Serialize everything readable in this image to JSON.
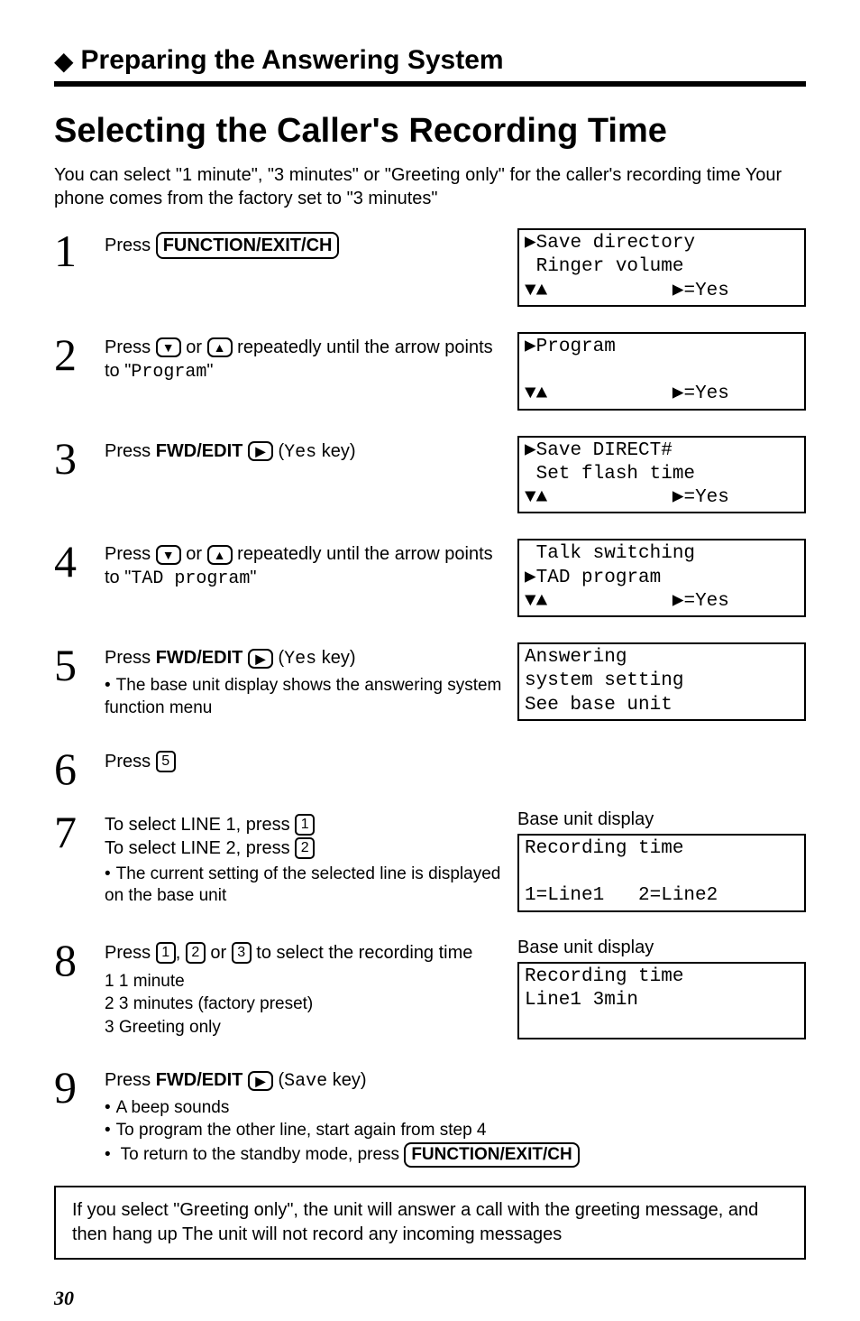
{
  "section": {
    "prefix_arrow": "◆",
    "title": "Preparing the Answering System"
  },
  "main_title": "Selecting the Caller's Recording Time",
  "intro": "You can select \"1 minute\", \"3 minutes\" or \"Greeting only\" for the caller's recording time  Your phone comes from the factory set to \"3 minutes\"",
  "keys": {
    "function_exit_ch": "FUNCTION/EXIT/CH",
    "fwd_edit": "FWD/EDIT",
    "down": "▼",
    "up": "▲",
    "play": "▶",
    "k1": "1",
    "k2": "2",
    "k3": "3",
    "k5": "5"
  },
  "steps": {
    "s1": {
      "num": "1",
      "text_a": "Press "
    },
    "s2": {
      "num": "2",
      "text_a": "Press ",
      "text_b": " or ",
      "text_c": " repeatedly until the arrow points to \"",
      "prog_word": "Program",
      "text_d": "\""
    },
    "s3": {
      "num": "3",
      "text_a": "Press ",
      "text_b": " (",
      "yes_word": "Yes",
      "text_c": " key)"
    },
    "s4": {
      "num": "4",
      "text_a": "Press ",
      "text_b": " or ",
      "text_c": " repeatedly until the arrow points to \"",
      "prog_word": "TAD program",
      "text_d": "\""
    },
    "s5": {
      "num": "5",
      "text_a": "Press ",
      "text_b": " (",
      "yes_word": "Yes",
      "text_c": " key)",
      "bullet": "The base unit display shows the answering system function menu"
    },
    "s6": {
      "num": "6",
      "text_a": "Press "
    },
    "s7": {
      "num": "7",
      "line1_a": "To select LINE 1, press ",
      "line2_a": "To select LINE 2, press ",
      "bullet": "The current setting of the selected line is displayed on the base unit"
    },
    "s8": {
      "num": "8",
      "text_a": "Press ",
      "text_b": ", ",
      "text_c": " or ",
      "text_d": " to select the recording time",
      "opt1": "1  1 minute",
      "opt2": "2  3 minutes (factory preset)",
      "opt3": "3  Greeting only"
    },
    "s9": {
      "num": "9",
      "text_a": "Press ",
      "text_b": " (",
      "save_word": "Save",
      "text_c": " key)",
      "b1": "A beep sounds",
      "b2": "To program the other line, start again from step 4",
      "b3_a": "To return to the standby mode, press "
    }
  },
  "lcd": {
    "d1": {
      "l1": "▶Save directory",
      "l2": " Ringer volume",
      "l3": "▼▲           ▶=Yes"
    },
    "d2": {
      "l1": "▶Program",
      "l2": " ",
      "l3": "▼▲           ▶=Yes"
    },
    "d3": {
      "l1": "▶Save DIRECT#",
      "l2": " Set flash time",
      "l3": "▼▲           ▶=Yes"
    },
    "d4": {
      "l1": " Talk switching",
      "l2": "▶TAD program",
      "l3": "▼▲           ▶=Yes"
    },
    "d5": {
      "l1": "Answering",
      "l2": "system setting",
      "l3": "See base unit"
    },
    "d7cap": "Base unit display",
    "d7": {
      "l1": "Recording time",
      "l2": " ",
      "l3": "1=Line1   2=Line2"
    },
    "d8cap": "Base unit display",
    "d8": {
      "l1": "Recording time",
      "l2": "Line1 3min",
      "l3": " "
    }
  },
  "note": "If you select \"Greeting only\", the unit will answer a call with the greeting message, and then hang up  The unit will not record any incoming messages",
  "page_number": "30"
}
